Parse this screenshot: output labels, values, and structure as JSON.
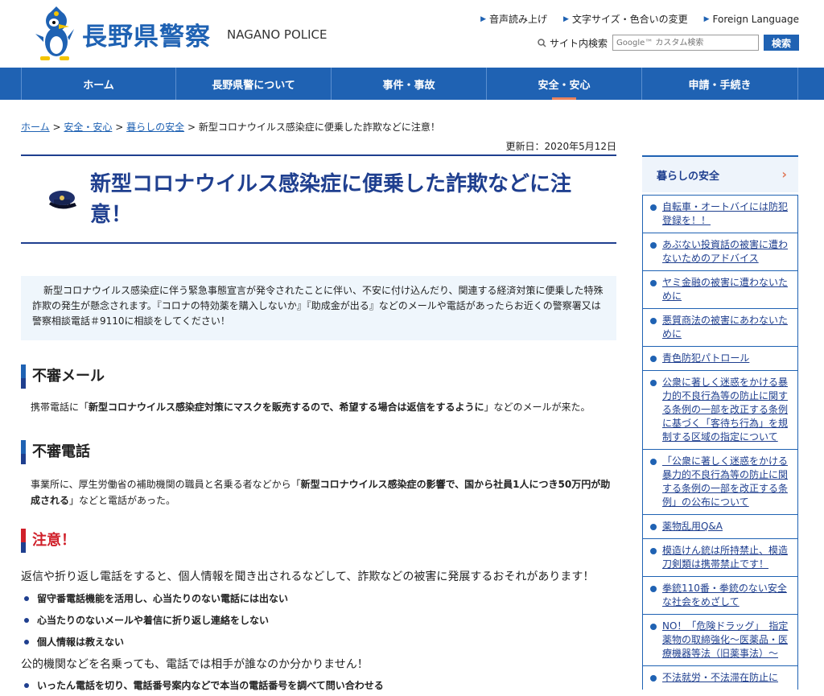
{
  "header": {
    "logo_text": "長野県警察",
    "logo_sub": "NAGANO POLICE",
    "util_links": [
      "音声読み上げ",
      "文字サイズ・色合いの変更",
      "Foreign Language"
    ],
    "search_label": "サイト内検索",
    "search_placeholder": "Google™ カスタム検索",
    "search_button": "検索"
  },
  "nav": {
    "items": [
      "ホーム",
      "長野県警について",
      "事件・事故",
      "安全・安心",
      "申請・手続き"
    ],
    "active": "安全・安心"
  },
  "breadcrumb": {
    "items": [
      "ホーム",
      "安全・安心",
      "暮らしの安全"
    ],
    "separator": ">",
    "current": "新型コロナウイルス感染症に便乗した詐欺などに注意！"
  },
  "updated": "更新日：2020年5月12日",
  "title": "新型コロナウイルス感染症に便乗した詐欺などに注意！",
  "intro": "新型コロナウイルス感染症に伴う緊急事態宣言が発令されたことに伴い、不安に付け込んだり、関連する経済対策に便乗した特殊詐欺の発生が懸念されます。『コロナの特効薬を購入しないか』『助成金が出る』などのメールや電話があったらお近くの警察署又は警察相談電話＃9110に相談をしてください！",
  "sections": {
    "mail": {
      "heading": "不審メール",
      "pre": "携帯電話に「",
      "bold": "新型コロナウイルス感染症対策にマスクを販売するので、希望する場合は返信をするように",
      "post": "」などのメールが来た。"
    },
    "phone": {
      "heading": "不審電話",
      "pre": "事業所に、厚生労働省の補助機関の職員と名乗る者などから「",
      "bold": "新型コロナウイルス感染症の影響で、国から社員1人につき50万円が助成される",
      "post": "」などと電話があった。"
    },
    "caution": {
      "heading": "注意！",
      "text1": "返信や折り返し電話をすると、個人情報を聞き出されるなどして、詐欺などの被害に発展するおそれがあります！",
      "bullets1": [
        "留守番電話機能を活用し、心当たりのない電話には出ない",
        "心当たりのないメールや着信に折り返し連絡をしない",
        "個人情報は教えない"
      ],
      "text2": "公的機関などを名乗っても、電話では相手が誰なのか分かりません！",
      "bullets2": [
        "いったん電話を切り、電話番号案内などで本当の電話番号を調べて問い合わせる"
      ]
    }
  },
  "sidebar": {
    "heading": "暮らしの安全",
    "items": [
      "自転車・オートバイには防犯登録を！！",
      "あぶない投資話の被害に遭わないためのアドバイス",
      "ヤミ金融の被害に遭わないために",
      "悪質商法の被害にあわないために",
      "青色防犯パトロール",
      "公衆に著しく迷惑をかける暴力的不良行為等の防止に関する条例の一部を改正する条例に基づく「客待ち行為」を規制する区域の指定について",
      "「公衆に著しく迷惑をかける暴力的不良行為等の防止に関する条例の一部を改正する条例」の公布について",
      "薬物乱用Q&A",
      "模造けん銃は所持禁止、模造刀剣類は携帯禁止です！",
      "拳銃110番・拳銃のない安全な社会をめざして",
      "NO！「危険ドラッグ」　指定薬物の取締強化〜医薬品・医療機器等法（旧薬事法）〜",
      "不法就労・不法滞在防止に"
    ]
  },
  "colors": {
    "brand_blue": "#1f62b3",
    "navy": "#1f3f8f",
    "warn_red": "#d0202a",
    "accent_orange": "#e8825d"
  }
}
